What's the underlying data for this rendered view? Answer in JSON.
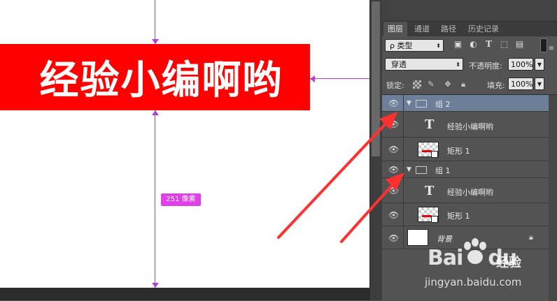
{
  "canvas": {
    "banner_text": "经验小编啊哟",
    "measure_label": "251 像素",
    "colors": {
      "banner": "#fe0000",
      "guide": "#b040d8",
      "measure": "#e040e8"
    }
  },
  "panel": {
    "tabs": [
      {
        "label": "图层",
        "active": true
      },
      {
        "label": "通道",
        "active": false
      },
      {
        "label": "路径",
        "active": false
      },
      {
        "label": "历史记录",
        "active": false
      }
    ],
    "filter": {
      "kind_label": "ρ 类型",
      "icons": [
        "image-filter-icon",
        "adjustment-filter-icon",
        "type-filter-icon",
        "shape-filter-icon",
        "smart-object-filter-icon"
      ]
    },
    "blend_mode": "穿透",
    "opacity_label": "不透明度:",
    "opacity_value": "100%",
    "lock_label": "锁定:",
    "fill_label": "填充:",
    "fill_value": "100%",
    "layers": [
      {
        "type": "group",
        "name": "组 2",
        "expanded": true,
        "selected": true
      },
      {
        "type": "text",
        "name": "经验小编啊哟",
        "thumb": "T"
      },
      {
        "type": "shape",
        "name": "矩形 1"
      },
      {
        "type": "group",
        "name": "组 1",
        "expanded": true,
        "selected": false
      },
      {
        "type": "text",
        "name": "经验小编啊哟",
        "thumb": "T"
      },
      {
        "type": "shape",
        "name": "矩形 1"
      },
      {
        "type": "background",
        "name": "背景",
        "locked": true
      }
    ]
  },
  "watermark": {
    "brand_bai": "Bai",
    "brand_du": "du",
    "brand_jingyan": "经验",
    "url": "jingyan.baidu.com"
  },
  "annotation_color": "#ff3030"
}
